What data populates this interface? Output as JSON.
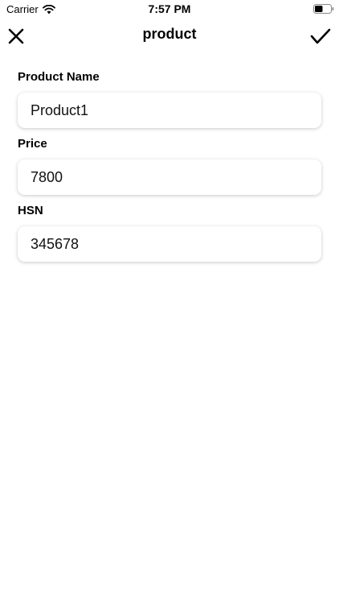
{
  "status_bar": {
    "carrier": "Carrier",
    "time": "7:57 PM",
    "battery_level": 0.5
  },
  "nav": {
    "title": "product",
    "close_icon": "close-icon",
    "done_icon": "checkmark-icon"
  },
  "form": {
    "fields": [
      {
        "label": "Product Name",
        "value": "Product1"
      },
      {
        "label": "Price",
        "value": "7800"
      },
      {
        "label": "HSN",
        "value": "345678"
      }
    ]
  }
}
